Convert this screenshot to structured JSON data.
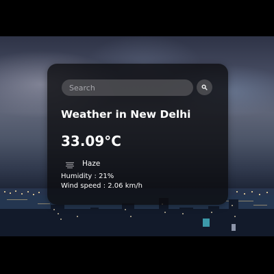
{
  "search": {
    "placeholder": "Search",
    "value": ""
  },
  "weather": {
    "title": "Weather in New Delhi",
    "temperature": "33.09°C",
    "condition": "Haze",
    "condition_icon": "haze-icon",
    "humidity": "Humidity : 21%",
    "wind": "Wind speed : 2.06 km/h"
  },
  "colors": {
    "card_background": "#0c0c0e",
    "text": "#ffffff",
    "input_background": "#55555a"
  }
}
